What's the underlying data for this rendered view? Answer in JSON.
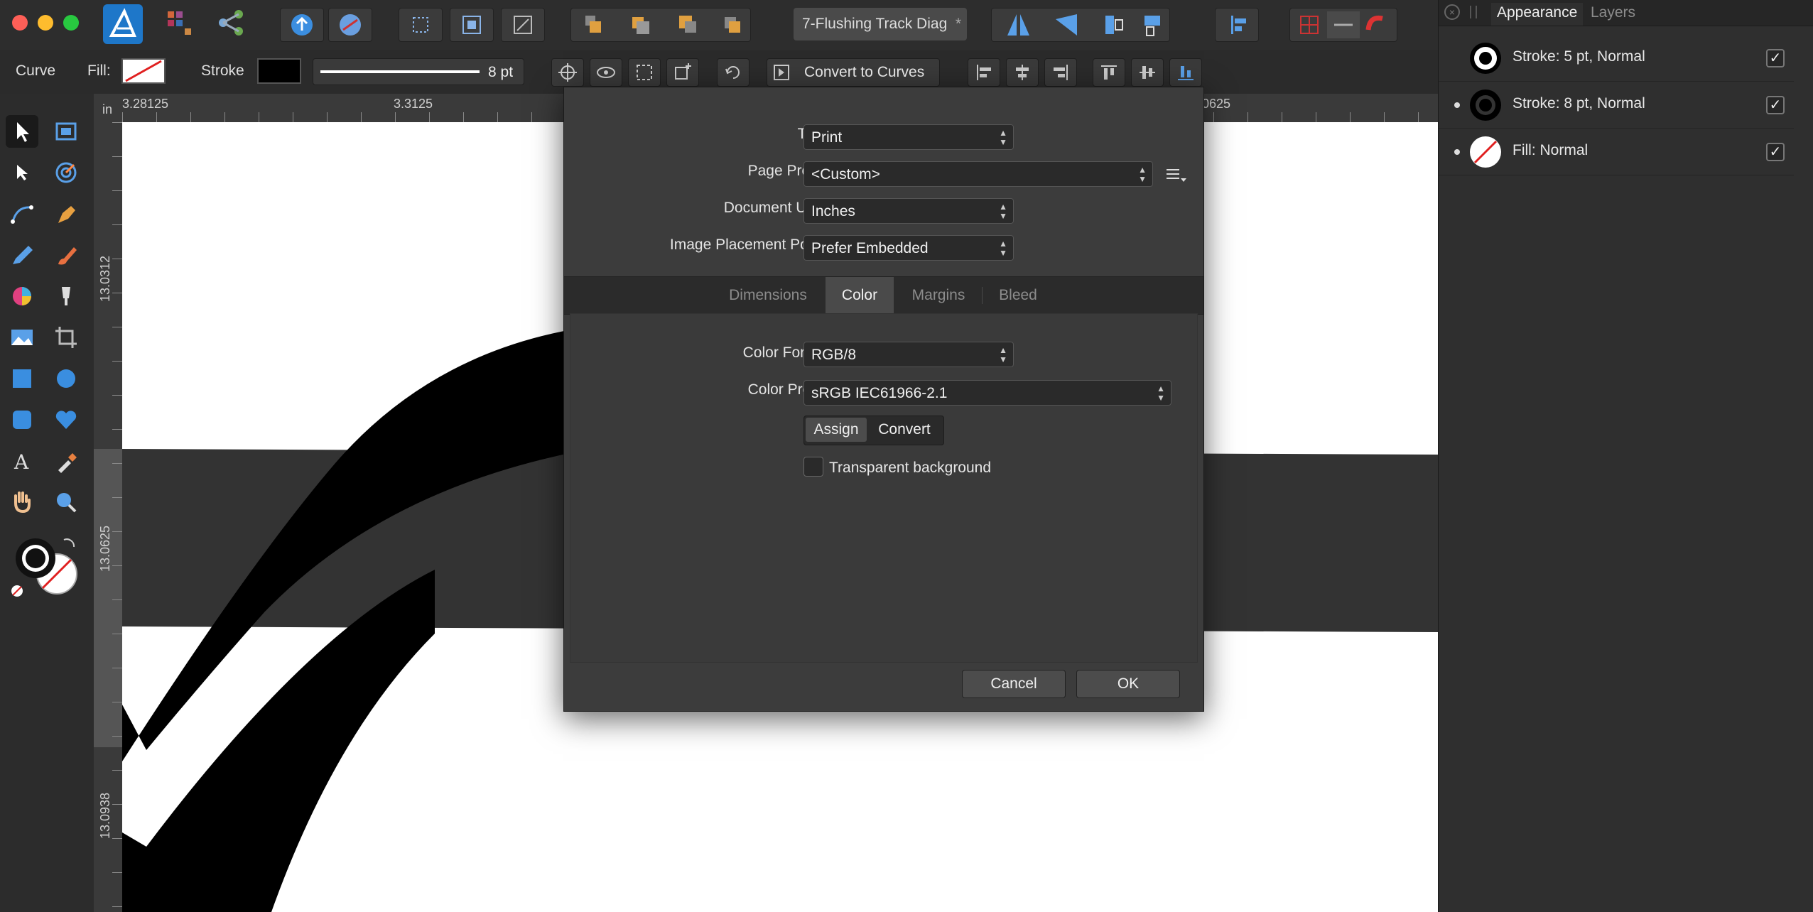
{
  "document": {
    "tab_title": "7-Flushing Track Diag",
    "modified_mark": "*"
  },
  "context_toolbar": {
    "tool_name": "Curve",
    "fill_label": "Fill:",
    "stroke_label": "Stroke",
    "stroke_width": "8 pt",
    "convert_button": "Convert to Curves"
  },
  "rulers": {
    "unit": "in",
    "top_ticks": [
      "3.28125",
      "3.3125",
      "0625"
    ],
    "left_ticks": [
      "13.0312",
      "13.0625",
      "13.0938"
    ]
  },
  "panel": {
    "tabs": [
      "Appearance",
      "Layers"
    ],
    "active_tab": "Appearance",
    "rows": [
      {
        "label": "Stroke: 5 pt, Normal",
        "checked": "✓",
        "icon": "stroke-thin-ring-icon"
      },
      {
        "label": "Stroke: 8 pt, Normal",
        "checked": "✓",
        "icon": "stroke-thick-ring-icon"
      },
      {
        "label": "Fill: Normal",
        "checked": "✓",
        "icon": "fill-none-icon"
      }
    ]
  },
  "dialog": {
    "type_label": "Type:",
    "type_value": "Print",
    "page_preset_label": "Page Preset:",
    "page_preset_value": "<Custom>",
    "units_label": "Document Units:",
    "units_value": "Inches",
    "placement_label": "Image Placement Policy:",
    "placement_value": "Prefer Embedded",
    "tabs": [
      "Dimensions",
      "Color",
      "Margins",
      "Bleed"
    ],
    "active_tab": "Color",
    "color_format_label": "Color Format:",
    "color_format_value": "RGB/8",
    "color_profile_label": "Color Profile:",
    "color_profile_value": "sRGB IEC61966-2.1",
    "assign_label": "Assign",
    "convert_label": "Convert",
    "transparent_label": "Transparent background",
    "cancel_label": "Cancel",
    "ok_label": "OK"
  },
  "colors": {
    "accent": "#2f8fd8",
    "canvas_band": "#333333",
    "stroke": "#000000"
  }
}
